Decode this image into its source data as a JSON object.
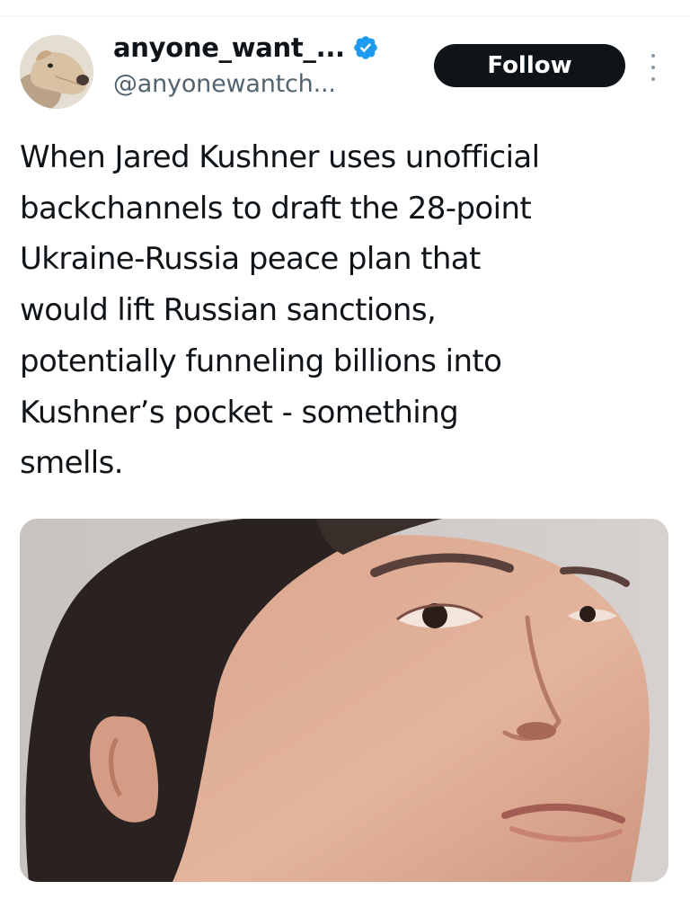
{
  "tweet": {
    "author": {
      "display_name": "anyone_want_...",
      "handle": "@anyonewantch...",
      "verified": true,
      "avatar_icon": "dog-avatar"
    },
    "follow_label": "Follow",
    "text": "When Jared Kushner uses unofficial\nbackchannels to draft the 28-point\nUkraine-Russia peace plan that\nwould lift Russian sanctions,\npotentially funneling billions into\nKushner’s pocket - something\nsmells."
  },
  "colors": {
    "text_primary": "#0f1419",
    "text_secondary": "#536471",
    "verified_blue": "#1d9bf0",
    "follow_bg": "#0f1419",
    "follow_text": "#ffffff"
  },
  "icons": {
    "verified": "verified-badge-icon",
    "more": "more-options-icon"
  }
}
